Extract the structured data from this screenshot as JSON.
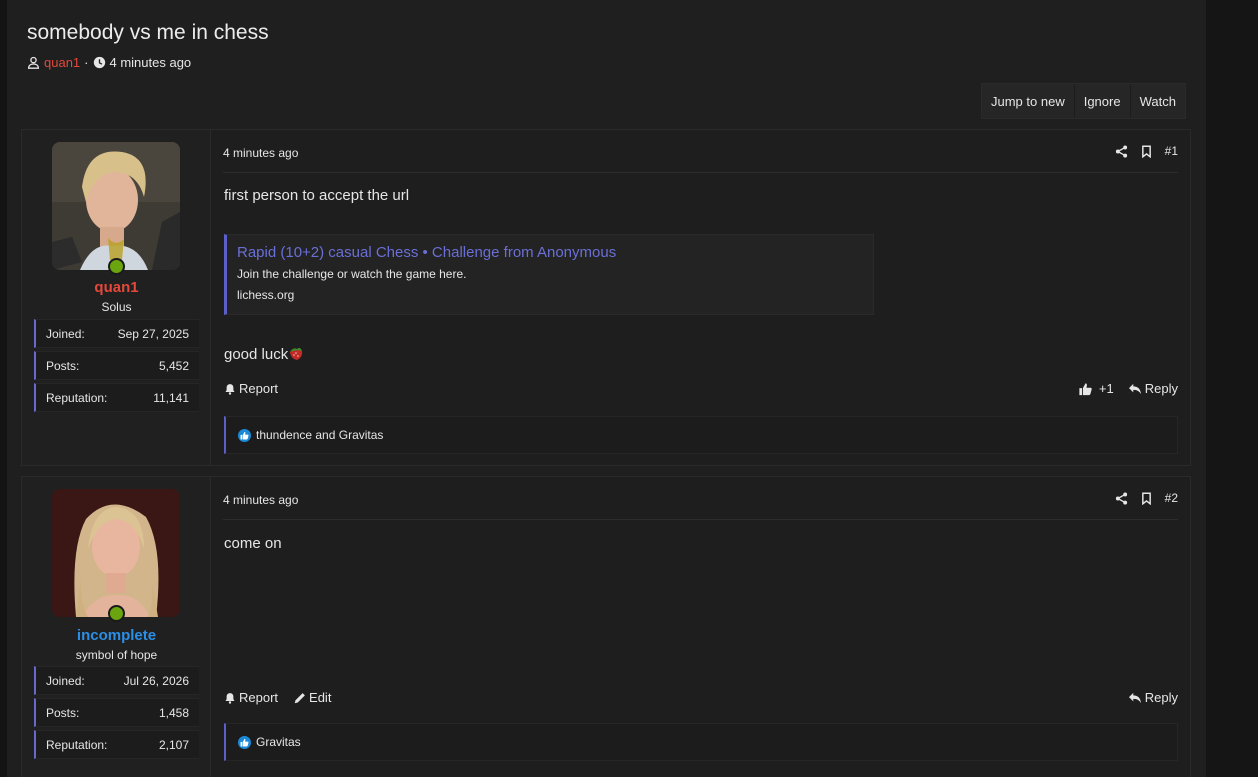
{
  "thread": {
    "title": "somebody vs me in chess",
    "author": "quan1",
    "separator": "·",
    "time": "4 minutes ago"
  },
  "actions": [
    "Jump to new",
    "Ignore",
    "Watch"
  ],
  "posts": [
    {
      "user": {
        "name": "quan1",
        "name_color": "#e5483b",
        "title": "Solus",
        "stats": [
          {
            "label": "Joined:",
            "value": "Sep 27, 2025"
          },
          {
            "label": "Posts:",
            "value": "5,452"
          },
          {
            "label": "Reputation:",
            "value": "11,141"
          }
        ]
      },
      "time": "4 minutes ago",
      "number": "#1",
      "text": "first person to accept the url",
      "embed": {
        "title": "Rapid (10+2) casual Chess • Challenge from Anonymous",
        "description": "Join the challenge or watch the game here.",
        "site": "lichess.org"
      },
      "text2": "good luck",
      "report": "Report",
      "like_count": "+1",
      "reply": "Reply",
      "reactions": "thundence and Gravitas"
    },
    {
      "user": {
        "name": "incomplete",
        "name_color": "#2b8fe6",
        "title": "symbol of hope",
        "stats": [
          {
            "label": "Joined:",
            "value": "Jul 26, 2026"
          },
          {
            "label": "Posts:",
            "value": "1,458"
          },
          {
            "label": "Reputation:",
            "value": "2,107"
          }
        ]
      },
      "time": "4 minutes ago",
      "number": "#2",
      "text": "come on",
      "report": "Report",
      "edit": "Edit",
      "reply": "Reply",
      "reactions": "Gravitas"
    }
  ],
  "colors": {
    "accent": "#5b5fc7",
    "author": "#e5483b",
    "online": "#6aa40e",
    "like": "#1a8ad8"
  }
}
